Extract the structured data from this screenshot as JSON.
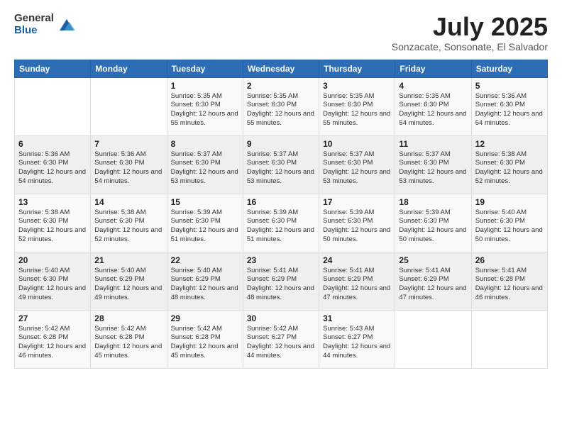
{
  "logo": {
    "general": "General",
    "blue": "Blue"
  },
  "title": "July 2025",
  "subtitle": "Sonzacate, Sonsonate, El Salvador",
  "headers": [
    "Sunday",
    "Monday",
    "Tuesday",
    "Wednesday",
    "Thursday",
    "Friday",
    "Saturday"
  ],
  "weeks": [
    [
      {
        "day": "",
        "sunrise": "",
        "sunset": "",
        "daylight": ""
      },
      {
        "day": "",
        "sunrise": "",
        "sunset": "",
        "daylight": ""
      },
      {
        "day": "1",
        "sunrise": "Sunrise: 5:35 AM",
        "sunset": "Sunset: 6:30 PM",
        "daylight": "Daylight: 12 hours and 55 minutes."
      },
      {
        "day": "2",
        "sunrise": "Sunrise: 5:35 AM",
        "sunset": "Sunset: 6:30 PM",
        "daylight": "Daylight: 12 hours and 55 minutes."
      },
      {
        "day": "3",
        "sunrise": "Sunrise: 5:35 AM",
        "sunset": "Sunset: 6:30 PM",
        "daylight": "Daylight: 12 hours and 55 minutes."
      },
      {
        "day": "4",
        "sunrise": "Sunrise: 5:35 AM",
        "sunset": "Sunset: 6:30 PM",
        "daylight": "Daylight: 12 hours and 54 minutes."
      },
      {
        "day": "5",
        "sunrise": "Sunrise: 5:36 AM",
        "sunset": "Sunset: 6:30 PM",
        "daylight": "Daylight: 12 hours and 54 minutes."
      }
    ],
    [
      {
        "day": "6",
        "sunrise": "Sunrise: 5:36 AM",
        "sunset": "Sunset: 6:30 PM",
        "daylight": "Daylight: 12 hours and 54 minutes."
      },
      {
        "day": "7",
        "sunrise": "Sunrise: 5:36 AM",
        "sunset": "Sunset: 6:30 PM",
        "daylight": "Daylight: 12 hours and 54 minutes."
      },
      {
        "day": "8",
        "sunrise": "Sunrise: 5:37 AM",
        "sunset": "Sunset: 6:30 PM",
        "daylight": "Daylight: 12 hours and 53 minutes."
      },
      {
        "day": "9",
        "sunrise": "Sunrise: 5:37 AM",
        "sunset": "Sunset: 6:30 PM",
        "daylight": "Daylight: 12 hours and 53 minutes."
      },
      {
        "day": "10",
        "sunrise": "Sunrise: 5:37 AM",
        "sunset": "Sunset: 6:30 PM",
        "daylight": "Daylight: 12 hours and 53 minutes."
      },
      {
        "day": "11",
        "sunrise": "Sunrise: 5:37 AM",
        "sunset": "Sunset: 6:30 PM",
        "daylight": "Daylight: 12 hours and 53 minutes."
      },
      {
        "day": "12",
        "sunrise": "Sunrise: 5:38 AM",
        "sunset": "Sunset: 6:30 PM",
        "daylight": "Daylight: 12 hours and 52 minutes."
      }
    ],
    [
      {
        "day": "13",
        "sunrise": "Sunrise: 5:38 AM",
        "sunset": "Sunset: 6:30 PM",
        "daylight": "Daylight: 12 hours and 52 minutes."
      },
      {
        "day": "14",
        "sunrise": "Sunrise: 5:38 AM",
        "sunset": "Sunset: 6:30 PM",
        "daylight": "Daylight: 12 hours and 52 minutes."
      },
      {
        "day": "15",
        "sunrise": "Sunrise: 5:39 AM",
        "sunset": "Sunset: 6:30 PM",
        "daylight": "Daylight: 12 hours and 51 minutes."
      },
      {
        "day": "16",
        "sunrise": "Sunrise: 5:39 AM",
        "sunset": "Sunset: 6:30 PM",
        "daylight": "Daylight: 12 hours and 51 minutes."
      },
      {
        "day": "17",
        "sunrise": "Sunrise: 5:39 AM",
        "sunset": "Sunset: 6:30 PM",
        "daylight": "Daylight: 12 hours and 50 minutes."
      },
      {
        "day": "18",
        "sunrise": "Sunrise: 5:39 AM",
        "sunset": "Sunset: 6:30 PM",
        "daylight": "Daylight: 12 hours and 50 minutes."
      },
      {
        "day": "19",
        "sunrise": "Sunrise: 5:40 AM",
        "sunset": "Sunset: 6:30 PM",
        "daylight": "Daylight: 12 hours and 50 minutes."
      }
    ],
    [
      {
        "day": "20",
        "sunrise": "Sunrise: 5:40 AM",
        "sunset": "Sunset: 6:30 PM",
        "daylight": "Daylight: 12 hours and 49 minutes."
      },
      {
        "day": "21",
        "sunrise": "Sunrise: 5:40 AM",
        "sunset": "Sunset: 6:29 PM",
        "daylight": "Daylight: 12 hours and 49 minutes."
      },
      {
        "day": "22",
        "sunrise": "Sunrise: 5:40 AM",
        "sunset": "Sunset: 6:29 PM",
        "daylight": "Daylight: 12 hours and 48 minutes."
      },
      {
        "day": "23",
        "sunrise": "Sunrise: 5:41 AM",
        "sunset": "Sunset: 6:29 PM",
        "daylight": "Daylight: 12 hours and 48 minutes."
      },
      {
        "day": "24",
        "sunrise": "Sunrise: 5:41 AM",
        "sunset": "Sunset: 6:29 PM",
        "daylight": "Daylight: 12 hours and 47 minutes."
      },
      {
        "day": "25",
        "sunrise": "Sunrise: 5:41 AM",
        "sunset": "Sunset: 6:29 PM",
        "daylight": "Daylight: 12 hours and 47 minutes."
      },
      {
        "day": "26",
        "sunrise": "Sunrise: 5:41 AM",
        "sunset": "Sunset: 6:28 PM",
        "daylight": "Daylight: 12 hours and 46 minutes."
      }
    ],
    [
      {
        "day": "27",
        "sunrise": "Sunrise: 5:42 AM",
        "sunset": "Sunset: 6:28 PM",
        "daylight": "Daylight: 12 hours and 46 minutes."
      },
      {
        "day": "28",
        "sunrise": "Sunrise: 5:42 AM",
        "sunset": "Sunset: 6:28 PM",
        "daylight": "Daylight: 12 hours and 45 minutes."
      },
      {
        "day": "29",
        "sunrise": "Sunrise: 5:42 AM",
        "sunset": "Sunset: 6:28 PM",
        "daylight": "Daylight: 12 hours and 45 minutes."
      },
      {
        "day": "30",
        "sunrise": "Sunrise: 5:42 AM",
        "sunset": "Sunset: 6:27 PM",
        "daylight": "Daylight: 12 hours and 44 minutes."
      },
      {
        "day": "31",
        "sunrise": "Sunrise: 5:43 AM",
        "sunset": "Sunset: 6:27 PM",
        "daylight": "Daylight: 12 hours and 44 minutes."
      },
      {
        "day": "",
        "sunrise": "",
        "sunset": "",
        "daylight": ""
      },
      {
        "day": "",
        "sunrise": "",
        "sunset": "",
        "daylight": ""
      }
    ]
  ]
}
